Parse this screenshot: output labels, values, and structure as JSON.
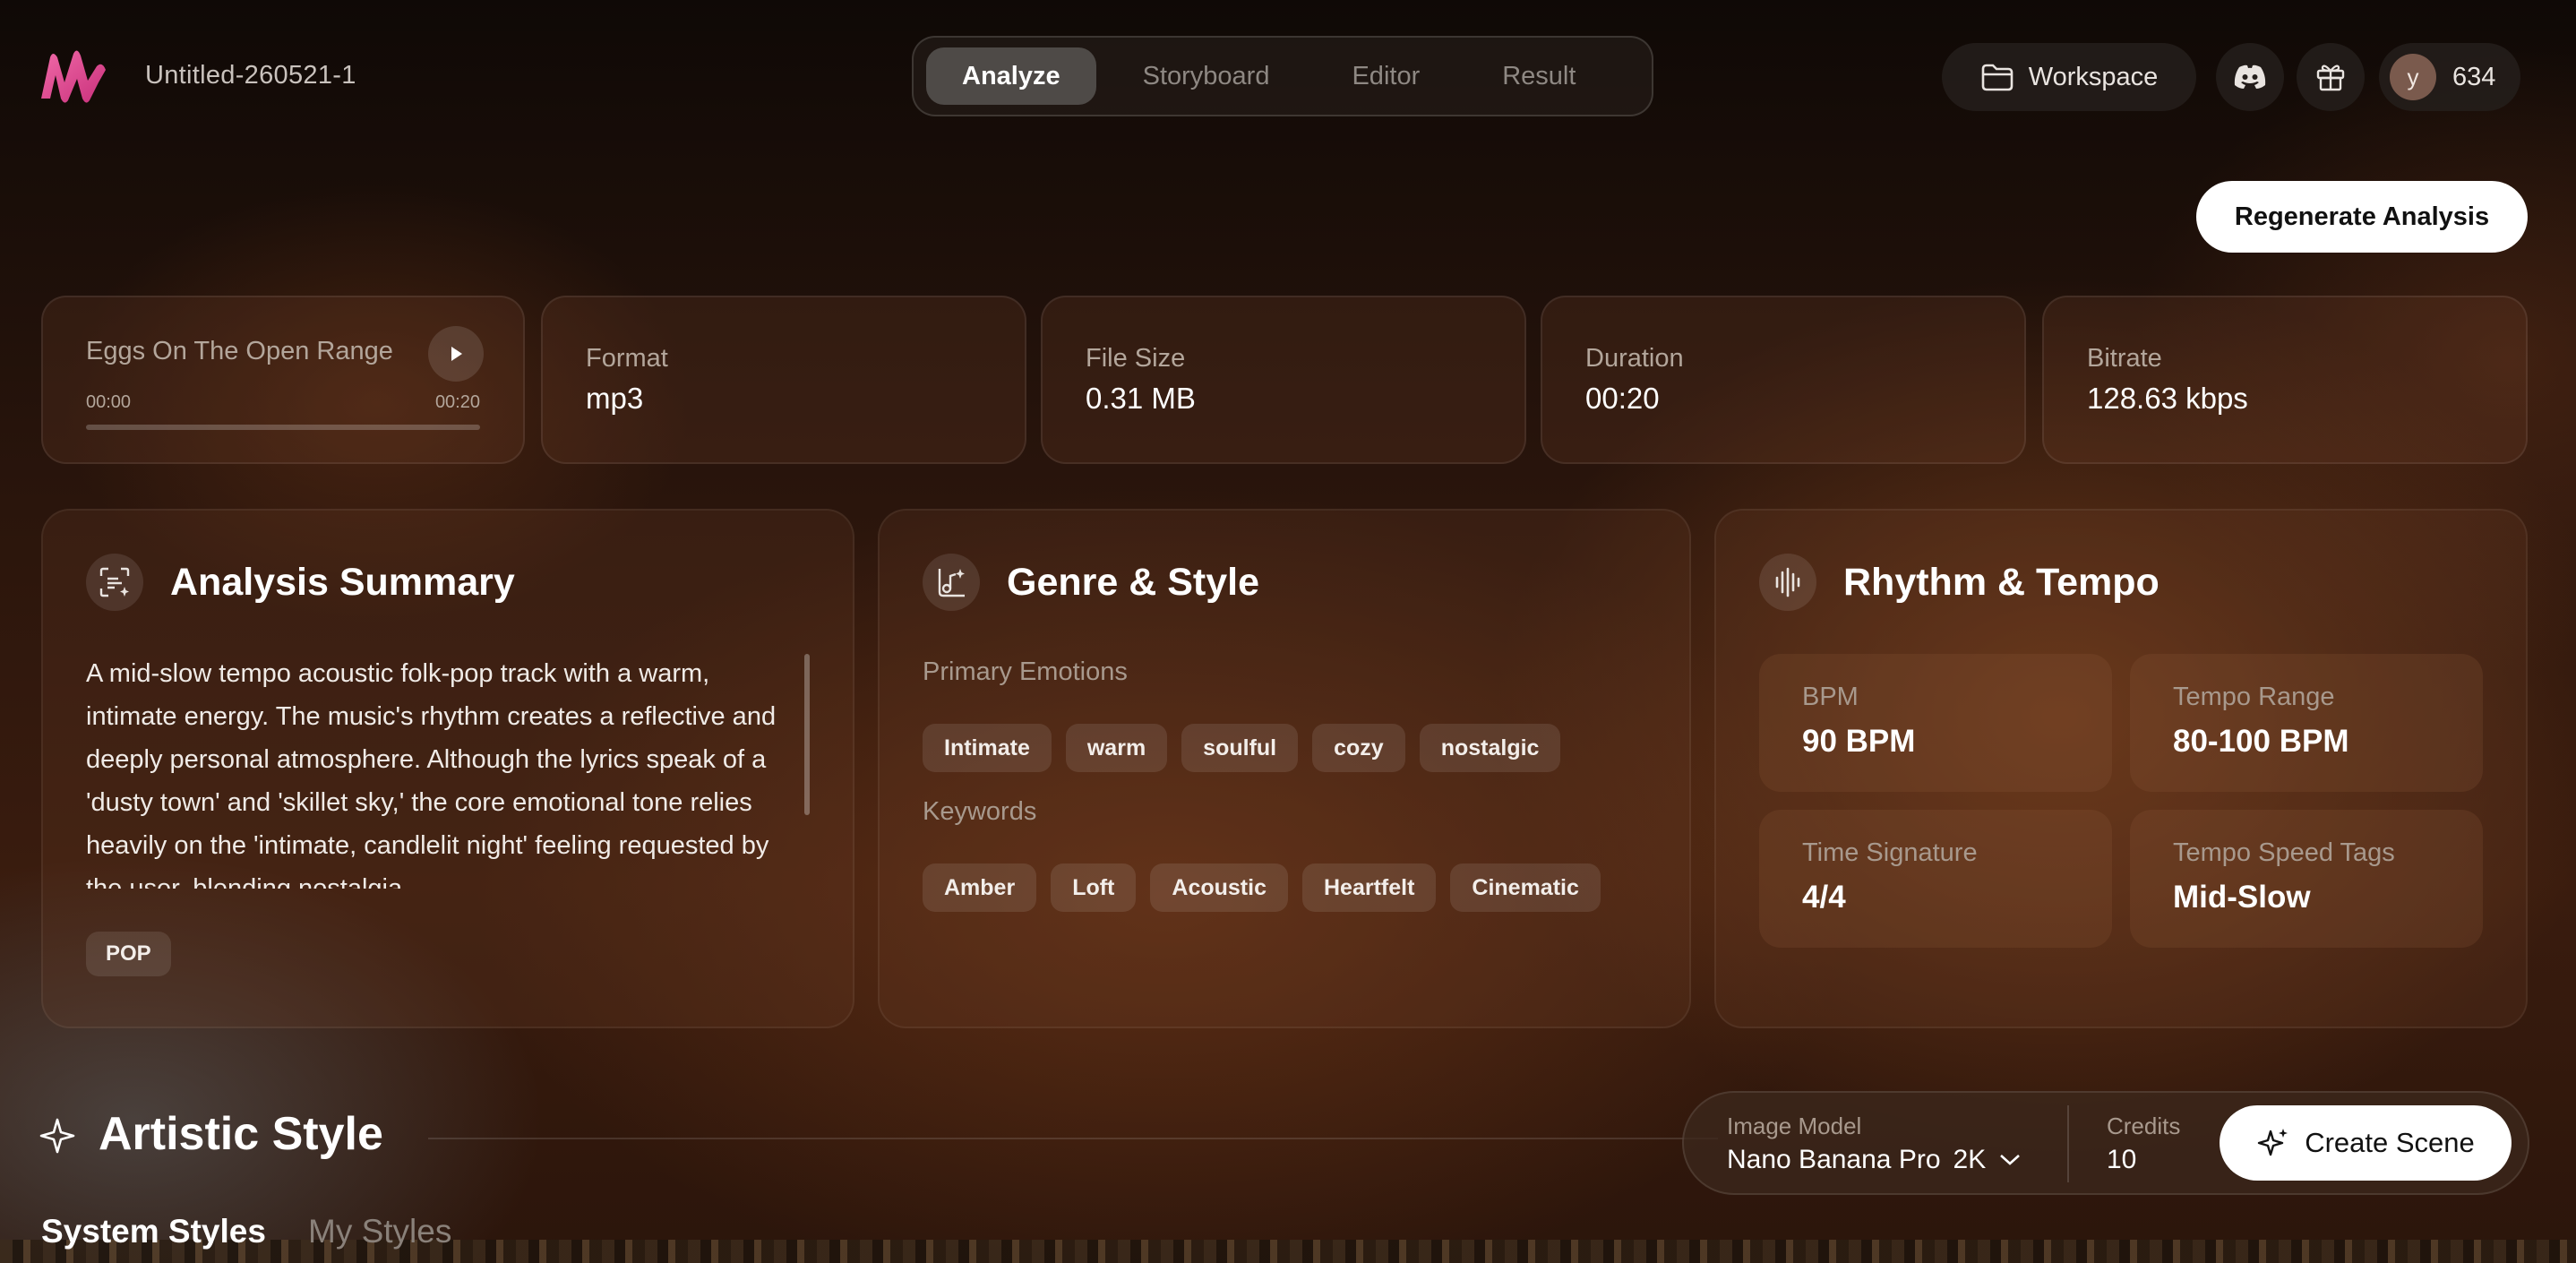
{
  "app": {
    "project_title": "Untitled-260521-1",
    "tabs": [
      {
        "label": "Analyze",
        "active": true
      },
      {
        "label": "Storyboard",
        "active": false
      },
      {
        "label": "Editor",
        "active": false
      },
      {
        "label": "Result",
        "active": false
      }
    ],
    "workspace_label": "Workspace",
    "avatar_initial": "y",
    "credits_balance": "634",
    "icons": [
      "logo-icon",
      "folder-icon",
      "discord-icon",
      "gift-icon",
      "play-icon",
      "scan-sparkle-icon",
      "music-sparkle-icon",
      "waveform-icon",
      "sparkle-icon",
      "chevron-down-icon"
    ],
    "accent_colors": {
      "logo": "#e0559b",
      "primary_button": "#ffffff"
    }
  },
  "regenerate_label": "Regenerate Analysis",
  "player": {
    "song_title": "Eggs On The Open Range",
    "current_time": "00:00",
    "total_time": "00:20",
    "progress": 0
  },
  "file_info": [
    {
      "label": "Format",
      "value": "mp3"
    },
    {
      "label": "File Size",
      "value": "0.31 MB"
    },
    {
      "label": "Duration",
      "value": "00:20"
    },
    {
      "label": "Bitrate",
      "value": "128.63 kbps"
    }
  ],
  "summary": {
    "title": "Analysis Summary",
    "text": "A mid-slow tempo acoustic folk-pop track with a warm, intimate energy. The music's rhythm creates a reflective and deeply personal atmosphere. Although the lyrics speak of a 'dusty town' and 'skillet sky,' the core emotional tone relies heavily on the 'intimate, candlelit night' feeling requested by the user, blending nostalgia",
    "tag": "POP"
  },
  "genre": {
    "title": "Genre & Style",
    "emotions_label": "Primary Emotions",
    "emotions": [
      "Intimate",
      "warm",
      "soulful",
      "cozy",
      "nostalgic"
    ],
    "keywords_label": "Keywords",
    "keywords": [
      "Amber",
      "Loft",
      "Acoustic",
      "Heartfelt",
      "Cinematic"
    ]
  },
  "rhythm": {
    "title": "Rhythm & Tempo",
    "stats": [
      {
        "label": "BPM",
        "value": "90 BPM"
      },
      {
        "label": "Tempo Range",
        "value": "80-100 BPM"
      },
      {
        "label": "Time Signature",
        "value": "4/4"
      },
      {
        "label": "Tempo Speed Tags",
        "value": "Mid-Slow"
      }
    ]
  },
  "artistic": {
    "title": "Artistic Style",
    "tabs": [
      {
        "label": "System Styles",
        "active": true
      },
      {
        "label": "My Styles",
        "active": false
      }
    ]
  },
  "create_bar": {
    "image_model_label": "Image Model",
    "image_model_value": "Nano Banana Pro",
    "resolution": "2K",
    "credits_label": "Credits",
    "credits_value": "10",
    "create_label": "Create Scene"
  }
}
